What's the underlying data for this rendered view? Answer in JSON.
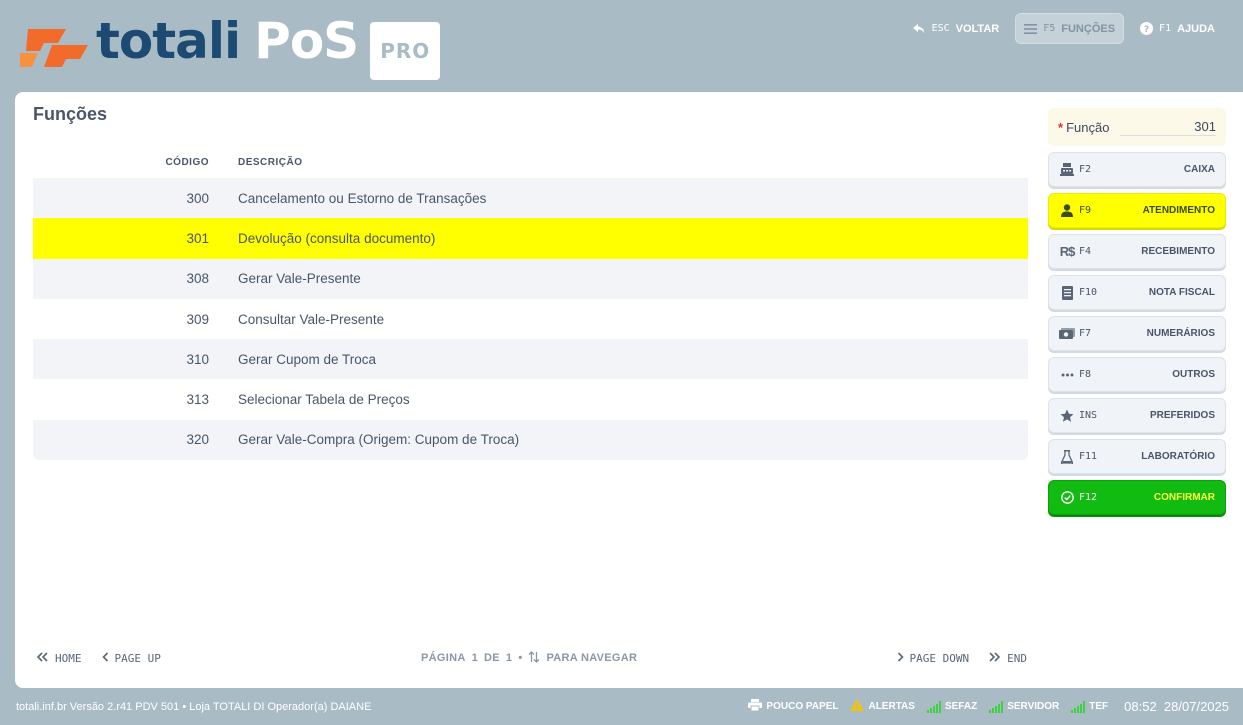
{
  "app": {
    "brand": "totali",
    "product": "PoS",
    "edition": "PRO",
    "colors": {
      "brand_orange": "#f26b2a",
      "brand_blue": "#1d4a73",
      "selection": "#ffff00",
      "confirm": "#11bb11"
    }
  },
  "top_actions": [
    {
      "key": "ESC",
      "label": "VOLTAR",
      "icon": "undo-arrow-icon",
      "active": false
    },
    {
      "key": "F5",
      "label": "FUNÇÕES",
      "icon": "menu-lines-icon",
      "active": true
    },
    {
      "key": "F1",
      "label": "AJUDA",
      "icon": "help-circle-icon",
      "active": false
    }
  ],
  "page": {
    "title": "Funções"
  },
  "table": {
    "headers": {
      "code": "CÓDIGO",
      "description": "DESCRIÇÃO"
    },
    "rows": [
      {
        "code": "300",
        "description": "Cancelamento ou Estorno de Transações",
        "selected": false
      },
      {
        "code": "301",
        "description": "Devolução (consulta documento)",
        "selected": true
      },
      {
        "code": "308",
        "description": "Gerar Vale-Presente",
        "selected": false
      },
      {
        "code": "309",
        "description": "Consultar Vale-Presente",
        "selected": false
      },
      {
        "code": "310",
        "description": "Gerar Cupom de Troca",
        "selected": false
      },
      {
        "code": "313",
        "description": "Selecionar Tabela de Preços",
        "selected": false
      },
      {
        "code": "320",
        "description": "Gerar Vale-Compra (Origem: Cupom de Troca)",
        "selected": false
      }
    ]
  },
  "pager": {
    "home": "HOME",
    "page_up": "PAGE UP",
    "page_label": "PÁGINA",
    "current": "1",
    "of_label": "DE",
    "total": "1",
    "navigate_label": "PARA NAVEGAR",
    "page_down": "PAGE DOWN",
    "end": "END"
  },
  "function_field": {
    "label": "Função",
    "value": "301"
  },
  "side_buttons": [
    {
      "key": "F2",
      "label": "CAIXA",
      "icon": "cash-register-icon",
      "style": "default"
    },
    {
      "key": "F9",
      "label": "ATENDIMENTO",
      "icon": "user-icon",
      "style": "yellow"
    },
    {
      "key": "F4",
      "label": "RECEBIMENTO",
      "icon": "currency-real-icon",
      "style": "default"
    },
    {
      "key": "F10",
      "label": "NOTA FISCAL",
      "icon": "document-icon",
      "style": "default"
    },
    {
      "key": "F7",
      "label": "NUMERÁRIOS",
      "icon": "money-bill-icon",
      "style": "default"
    },
    {
      "key": "F8",
      "label": "OUTROS",
      "icon": "ellipsis-icon",
      "style": "default"
    },
    {
      "key": "INS",
      "label": "PREFERIDOS",
      "icon": "star-icon",
      "style": "default"
    },
    {
      "key": "F11",
      "label": "LABORATÓRIO",
      "icon": "flask-icon",
      "style": "default"
    },
    {
      "key": "F12",
      "label": "CONFIRMAR",
      "icon": "check-circle-icon",
      "style": "green"
    }
  ],
  "footer": {
    "info": "totali.inf.br Versão 2.r41 PDV 501  •  Loja TOTALI DI Operador(a) DAIANE",
    "status": [
      {
        "label": "POUCO PAPEL",
        "icon": "printer-icon"
      },
      {
        "label": "ALERTAS",
        "icon": "warning-icon"
      },
      {
        "label": "SEFAZ",
        "icon": "signal-icon"
      },
      {
        "label": "SERVIDOR",
        "icon": "signal-icon"
      },
      {
        "label": "TEF",
        "icon": "signal-icon"
      }
    ],
    "time": "08:52",
    "date": "28/07/2025"
  }
}
